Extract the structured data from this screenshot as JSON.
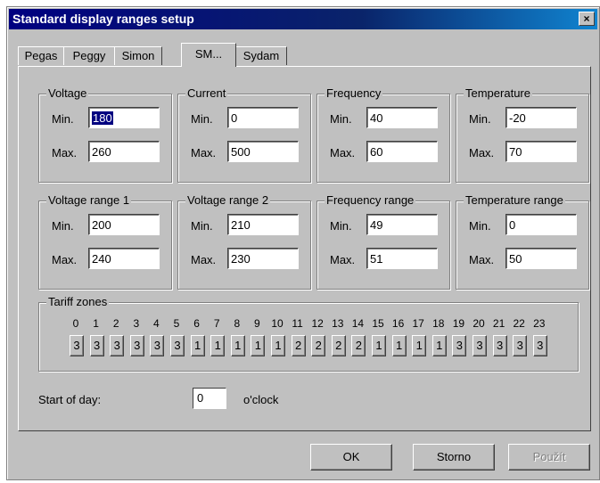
{
  "window": {
    "title": "Standard display ranges setup",
    "close": "×"
  },
  "tabs": [
    "Pegas",
    "Peggy",
    "Simon",
    "SM...",
    "Sydam"
  ],
  "groups": {
    "voltage": {
      "title": "Voltage",
      "min_label": "Min.",
      "max_label": "Max.",
      "min": "180",
      "max": "260"
    },
    "current": {
      "title": "Current",
      "min_label": "Min.",
      "max_label": "Max.",
      "min": "0",
      "max": "500"
    },
    "frequency": {
      "title": "Frequency",
      "min_label": "Min.",
      "max_label": "Max.",
      "min": "40",
      "max": "60"
    },
    "temperature": {
      "title": "Temperature",
      "min_label": "Min.",
      "max_label": "Max.",
      "min": "-20",
      "max": "70"
    },
    "voltage_range_1": {
      "title": "Voltage range 1",
      "min_label": "Min.",
      "max_label": "Max.",
      "min": "200",
      "max": "240"
    },
    "voltage_range_2": {
      "title": "Voltage range 2",
      "min_label": "Min.",
      "max_label": "Max.",
      "min": "210",
      "max": "230"
    },
    "frequency_range": {
      "title": "Frequency range",
      "min_label": "Min.",
      "max_label": "Max.",
      "min": "49",
      "max": "51"
    },
    "temperature_range": {
      "title": "Temperature range",
      "min_label": "Min.",
      "max_label": "Max.",
      "min": "0",
      "max": "50"
    }
  },
  "tariff": {
    "title": "Tariff zones",
    "hours": [
      "0",
      "1",
      "2",
      "3",
      "4",
      "5",
      "6",
      "7",
      "8",
      "9",
      "10",
      "11",
      "12",
      "13",
      "14",
      "15",
      "16",
      "17",
      "18",
      "19",
      "20",
      "21",
      "22",
      "23"
    ],
    "zones": [
      "3",
      "3",
      "3",
      "3",
      "3",
      "3",
      "1",
      "1",
      "1",
      "1",
      "1",
      "2",
      "2",
      "2",
      "2",
      "1",
      "1",
      "1",
      "1",
      "3",
      "3",
      "3",
      "3",
      "3"
    ]
  },
  "start_of_day": {
    "label": "Start of day:",
    "value": "0",
    "unit": "o'clock"
  },
  "buttons": {
    "ok": "OK",
    "cancel": "Storno",
    "apply": "Použít"
  }
}
